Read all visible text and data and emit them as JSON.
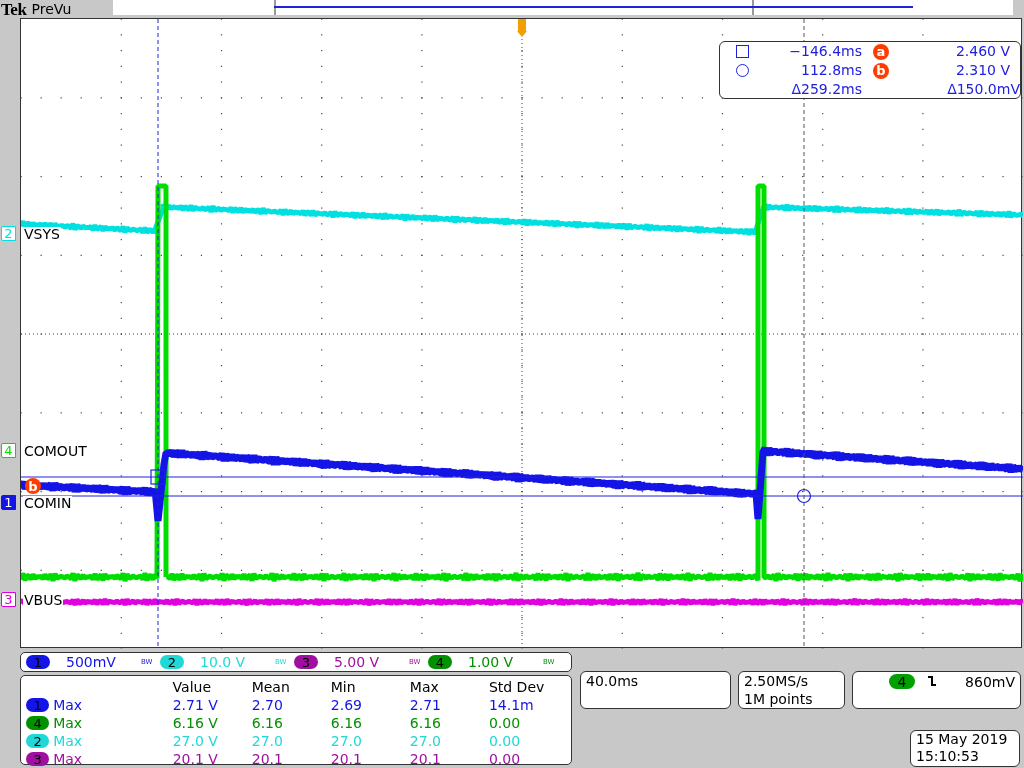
{
  "header": {
    "brand": "Tek",
    "mode": "PreVu"
  },
  "waveforms": [
    {
      "channel": "2",
      "label": "VSYS",
      "color": "#00e0e0",
      "selected": false
    },
    {
      "channel": "4",
      "label": "COMOUT",
      "color": "#00dd00",
      "selected": false
    },
    {
      "channel": "1",
      "label": "COMIN",
      "color": "#1414e6",
      "selected": true
    },
    {
      "channel": "3",
      "label": "VBUS",
      "color": "#e000e0",
      "selected": false
    }
  ],
  "cursor_marker_b": "b",
  "cursor_readout": {
    "time_1": "−146.4ms",
    "time_2": "112.8ms",
    "delta_time": "Δ259.2ms",
    "marker_a": "a",
    "value_a": "2.460 V",
    "marker_b": "b",
    "value_b": "2.310 V",
    "delta_value": "Δ150.0mV"
  },
  "channel_scales": [
    {
      "channel": "1",
      "scale": "500mV",
      "bandwidth": "BW",
      "color": "#1414e6"
    },
    {
      "channel": "2",
      "scale": "10.0 V",
      "bandwidth": "BW",
      "color": "#20d8d8"
    },
    {
      "channel": "3",
      "scale": "5.00 V",
      "bandwidth": "BW",
      "color": "#a010a0"
    },
    {
      "channel": "4",
      "scale": "1.00 V",
      "bandwidth": "BW",
      "color": "#009000"
    }
  ],
  "measurements": {
    "columns": [
      "Value",
      "Mean",
      "Min",
      "Max",
      "Std Dev"
    ],
    "rows": [
      {
        "channel": "1",
        "type": "Max",
        "color": "#1414e6",
        "cells": [
          "2.71 V",
          "2.70",
          "2.69",
          "2.71",
          "14.1m"
        ]
      },
      {
        "channel": "4",
        "type": "Max",
        "color": "#009000",
        "cells": [
          "6.16 V",
          "6.16",
          "6.16",
          "6.16",
          "0.00"
        ]
      },
      {
        "channel": "2",
        "type": "Max",
        "color": "#20d8d8",
        "cells": [
          "27.0 V",
          "27.0",
          "27.0",
          "27.0",
          "0.00"
        ]
      },
      {
        "channel": "3",
        "type": "Max",
        "color": "#a010a0",
        "cells": [
          "20.1 V",
          "20.1",
          "20.1",
          "20.1",
          "0.00"
        ]
      }
    ]
  },
  "timebase": "40.0ms",
  "acquisition": {
    "sample_rate": "2.50MS/s",
    "record_length": "1M points"
  },
  "trigger": {
    "channel": "4",
    "color": "#00a000",
    "level": "860mV"
  },
  "date": "15 May 2019",
  "time": "15:10:53"
}
